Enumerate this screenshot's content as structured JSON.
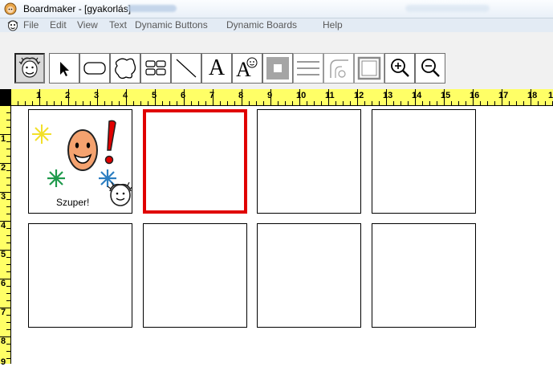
{
  "window": {
    "title": "Boardmaker - [gyakorlás]"
  },
  "menu": [
    "File",
    "Edit",
    "View",
    "Text",
    "Dynamic Buttons",
    "Dynamic Boards",
    "Help"
  ],
  "toolbar": {
    "tools": [
      {
        "name": "symbol-finder-tool",
        "icon": "face-icon"
      },
      {
        "name": "pointer-tool",
        "icon": "arrow-pointer-icon"
      },
      {
        "name": "button-tool",
        "icon": "rounded-rect-icon"
      },
      {
        "name": "freeform-button-tool",
        "icon": "freeform-shape-icon"
      },
      {
        "name": "button-sequence-tool",
        "icon": "grid-icon"
      },
      {
        "name": "line-tool",
        "icon": "line-icon"
      },
      {
        "name": "text-tool",
        "label": "A",
        "icon": "text-icon"
      },
      {
        "name": "symbol-text-tool",
        "label": "A",
        "icon": "symbol-text-icon"
      },
      {
        "name": "color-tool",
        "icon": "color-square-icon"
      },
      {
        "name": "line-thickness-tool",
        "icon": "line-thickness-icon"
      },
      {
        "name": "corner-tool",
        "icon": "rounded-corner-icon"
      },
      {
        "name": "border-tool",
        "icon": "border-icon"
      },
      {
        "name": "zoom-in-tool",
        "icon": "zoom-in-icon"
      },
      {
        "name": "zoom-out-tool",
        "icon": "zoom-out-icon"
      }
    ]
  },
  "ruler": {
    "top": [
      "1",
      "2",
      "3",
      "4",
      "5",
      "6",
      "7",
      "8",
      "9",
      "10",
      "11",
      "12",
      "13",
      "14",
      "15",
      "16",
      "17",
      "18",
      "1"
    ],
    "left": [
      "1",
      "2",
      "3",
      "4",
      "5",
      "6",
      "7",
      "8",
      "9"
    ]
  },
  "board": {
    "cells": [
      {
        "caption": "Szuper!",
        "symbol": "happy-egg-exclamation-stars"
      },
      {
        "selected": true
      },
      {},
      {},
      {},
      {},
      {},
      {}
    ]
  },
  "colors": {
    "ruler": "#ffff66",
    "selection": "#e00000",
    "egg": "#f4a26f",
    "exclamation": "#e00000"
  }
}
